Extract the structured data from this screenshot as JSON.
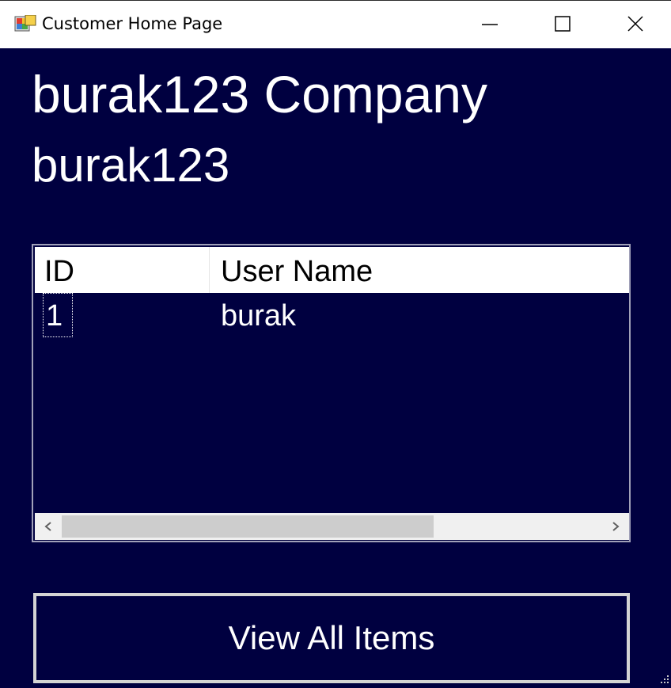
{
  "window": {
    "title": "Customer Home Page",
    "icons": {
      "app": "app-icon",
      "minimize": "minimize-icon",
      "maximize": "maximize-icon",
      "close": "close-icon"
    }
  },
  "content": {
    "company_label": "burak123 Company",
    "user_label": "burak123"
  },
  "users_list": {
    "columns": [
      "ID",
      "User Name"
    ],
    "rows": [
      {
        "id": "1",
        "user_name": "burak"
      }
    ],
    "scroll_icons": {
      "left": "chevron-left-icon",
      "right": "chevron-right-icon"
    }
  },
  "view_all_button": {
    "label": "View All Items"
  },
  "colors": {
    "background": "#000040",
    "text": "#ffffff",
    "header_bg": "#ffffff"
  }
}
